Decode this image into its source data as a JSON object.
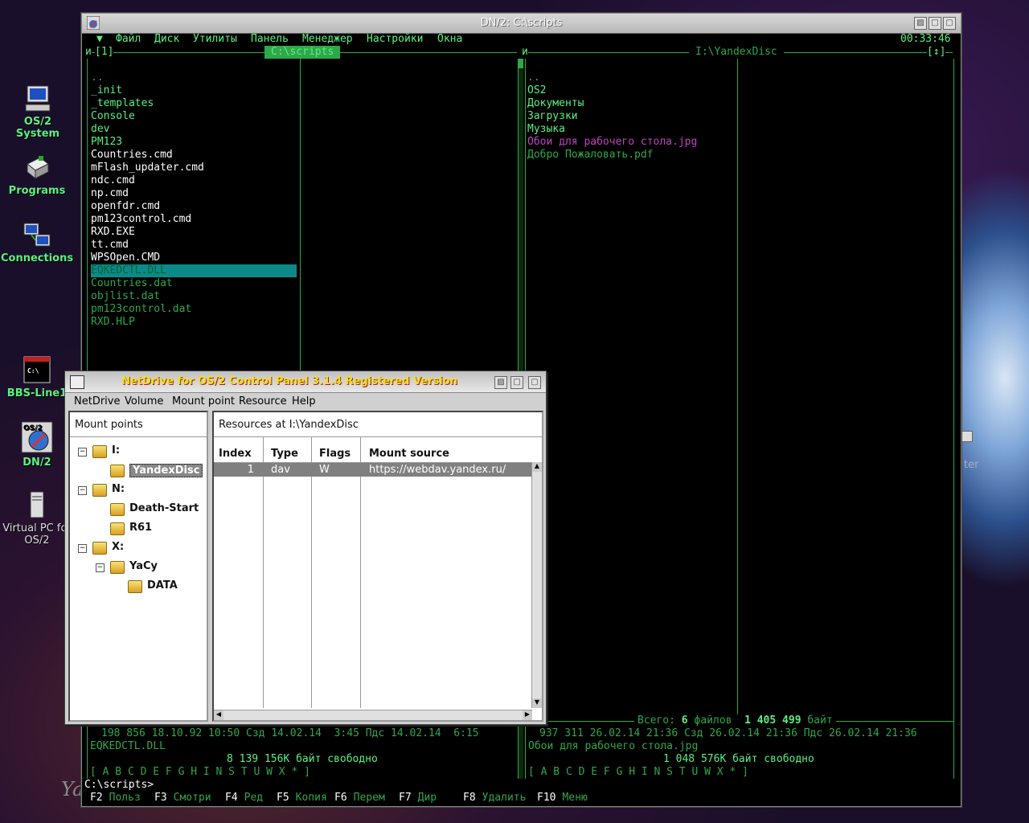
{
  "desktop": {
    "icons": [
      {
        "label": "OS/2 System",
        "icon": "computer-icon"
      },
      {
        "label": "Programs",
        "icon": "programs-icon"
      },
      {
        "label": "Connections",
        "icon": "network-icon"
      },
      {
        "label": "BBS-Line1",
        "icon": "terminal-icon"
      },
      {
        "label": "DN/2",
        "icon": "dn2-icon"
      },
      {
        "label": "Virtual PC for OS/2",
        "icon": "pc-tower-icon"
      }
    ],
    "partial_text": "ter",
    "signature": "Ya"
  },
  "dn": {
    "title": "DN/2: C:\\scripts",
    "clock": "00:33:46",
    "menu": [
      "Файл",
      "Диск",
      "Утилиты",
      "Панель",
      "Менеджер",
      "Настройки",
      "Окна"
    ],
    "menu_marker": "▼",
    "left": {
      "header": "C:\\scripts",
      "header_left": "и",
      "header_num": "[1]",
      "files": [
        {
          "name": "..",
          "c": "dg"
        },
        {
          "name": "_init",
          "c": "g"
        },
        {
          "name": "_templates",
          "c": "g"
        },
        {
          "name": "Console",
          "c": "g"
        },
        {
          "name": "dev",
          "c": "g"
        },
        {
          "name": "PM123",
          "c": "g"
        },
        {
          "name": "Countries.cmd",
          "c": "w"
        },
        {
          "name": "mFlash_updater.cmd",
          "c": "w"
        },
        {
          "name": "ndc.cmd",
          "c": "w"
        },
        {
          "name": "np.cmd",
          "c": "w"
        },
        {
          "name": "openfdr.cmd",
          "c": "w"
        },
        {
          "name": "pm123control.cmd",
          "c": "w"
        },
        {
          "name": "RXD.EXE",
          "c": "w"
        },
        {
          "name": "tt.cmd",
          "c": "w"
        },
        {
          "name": "WPSOpen.CMD",
          "c": "w"
        },
        {
          "name": "EQKEDCTL.DLL",
          "c": "sel"
        },
        {
          "name": "Countries.dat",
          "c": "dg"
        },
        {
          "name": "objlist.dat",
          "c": "dg"
        },
        {
          "name": "pm123control.dat",
          "c": "dg"
        },
        {
          "name": "RXD.HLP",
          "c": "dg"
        }
      ],
      "info1": "198 856 18.10.92 10:50 Сзд 14.02.14  3:45 Пдс 14.02.14  6:15",
      "info2": "EQKEDCTL.DLL",
      "free": "8 139 156K байт свободно",
      "drives": "[ A B C D E F G H I N S T U W X * ]"
    },
    "right": {
      "header": "I:\\YandexDisc",
      "header_left": "и",
      "header_right": "[↕]",
      "files": [
        {
          "name": "..",
          "c": "dg"
        },
        {
          "name": "OS2",
          "c": "g"
        },
        {
          "name": "Документы",
          "c": "g"
        },
        {
          "name": "Загрузки",
          "c": "g"
        },
        {
          "name": "Музыка",
          "c": "g"
        },
        {
          "name": "Обои для рабочего стола.jpg",
          "c": "mg"
        },
        {
          "name": "Добро Пожаловать.pdf",
          "c": "dg"
        }
      ],
      "total_label": "Всего:",
      "total_count": "6",
      "total_files": "файлов",
      "total_size": "1 405 499",
      "total_unit": "байт",
      "info1": "937 311 26.02.14 21:36 Сзд 26.02.14 21:36 Пдс 26.02.14 21:36",
      "info2": "Обои для рабочего стола.jpg",
      "free": "1 048 576K байт свободно",
      "drives": "[ A B C D E F G H I N S T U W X * ]"
    },
    "prompt": "C:\\scripts>",
    "fkeys": [
      {
        "k": "F2",
        "l": "Польз"
      },
      {
        "k": "F3",
        "l": "Смотри"
      },
      {
        "k": "F4",
        "l": "Ред"
      },
      {
        "k": "F5",
        "l": "Копия"
      },
      {
        "k": "F6",
        "l": "Перем"
      },
      {
        "k": "F7",
        "l": "Дир"
      },
      {
        "k": "F8",
        "l": "Удалить"
      },
      {
        "k": "F10",
        "l": "Меню"
      }
    ]
  },
  "netdrive": {
    "title": "NetDrive for OS/2 Control Panel 3.1.4 Registered Version",
    "menu": [
      "NetDrive",
      "Volume",
      "Mount point",
      "Resource",
      "Help"
    ],
    "mount_points_label": "Mount points",
    "tree": [
      {
        "label": "I:",
        "level": 0,
        "exp": "-"
      },
      {
        "label": "YandexDisc",
        "level": 1,
        "selected": true
      },
      {
        "label": "N:",
        "level": 0,
        "exp": "-"
      },
      {
        "label": "Death-Start",
        "level": 1
      },
      {
        "label": "R61",
        "level": 1
      },
      {
        "label": "X:",
        "level": 0,
        "exp": "-"
      },
      {
        "label": "YaCy",
        "level": 1,
        "exp": "-"
      },
      {
        "label": "DATA",
        "level": 2
      }
    ],
    "resources_label": "Resources at I:\\YandexDisc",
    "columns": [
      "Index",
      "Type",
      "Flags",
      "Mount source"
    ],
    "rows": [
      {
        "index": "1",
        "type": "dav",
        "flags": "W",
        "source": "https://webdav.yandex.ru/"
      }
    ]
  }
}
